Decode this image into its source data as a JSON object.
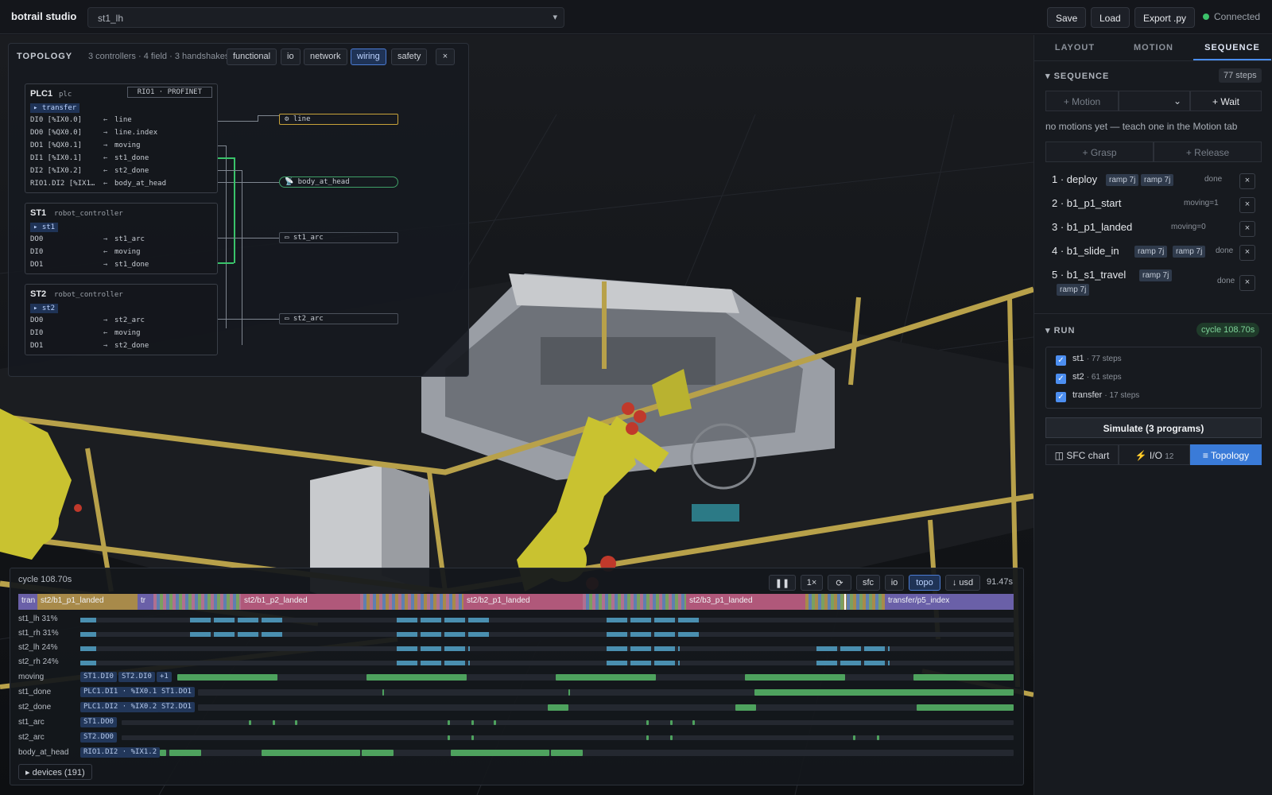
{
  "app": {
    "brand": "botrail studio",
    "project": "st1_lh",
    "save": "Save",
    "load": "Load",
    "export": "Export .py",
    "status": "Connected"
  },
  "topology": {
    "title": "TOPOLOGY",
    "summary": "3 controllers · 4 field · 3 handshakes",
    "chips": [
      "functional",
      "io",
      "network",
      "wiring",
      "safety"
    ],
    "close": "×",
    "plc1": {
      "name": "PLC1",
      "type": "plc",
      "rio": "RIO1 · PROFINET",
      "prog": "▸ transfer",
      "sigs": [
        [
          "DI0 [%IX0.0]",
          "←",
          "line"
        ],
        [
          "DO0 [%QX0.0]",
          "→",
          "line.index"
        ],
        [
          "DO1 [%QX0.1]",
          "→",
          "moving"
        ],
        [
          "DI1 [%IX0.1]",
          "←",
          "st1_done"
        ],
        [
          "DI2 [%IX0.2]",
          "←",
          "st2_done"
        ],
        [
          "RIO1.DI2 [%IX1…",
          "←",
          "body_at_head"
        ]
      ]
    },
    "st1": {
      "name": "ST1",
      "type": "robot_controller",
      "prog": "▸ st1",
      "sigs": [
        [
          "DO0",
          "→",
          "st1_arc"
        ],
        [
          "DI0",
          "←",
          "moving"
        ],
        [
          "DO1",
          "→",
          "st1_done"
        ]
      ]
    },
    "st2": {
      "name": "ST2",
      "type": "robot_controller",
      "prog": "▸ st2",
      "sigs": [
        [
          "DO0",
          "→",
          "st2_arc"
        ],
        [
          "DI0",
          "←",
          "moving"
        ],
        [
          "DO1",
          "→",
          "st2_done"
        ]
      ]
    },
    "devices": [
      "⚙ line",
      "📡 body_at_head",
      "▭ st1_arc",
      "▭ st2_arc"
    ]
  },
  "side": {
    "tabs": [
      "LAYOUT",
      "MOTION",
      "SEQUENCE"
    ],
    "sequence": {
      "title": "SEQUENCE",
      "count": "77 steps",
      "add_motion": "+ Motion",
      "add_wait": "+ Wait",
      "hint": "no motions yet — teach one in the Motion tab",
      "grasp": "+ Grasp",
      "release": "+ Release",
      "steps": [
        {
          "label": "1 · deploy",
          "tags": [
            "ramp 7j",
            "ramp 7j"
          ],
          "state": "done"
        },
        {
          "label": "2 · b1_p1_start",
          "tags": [],
          "state": "moving=1"
        },
        {
          "label": "3 · b1_p1_landed",
          "tags": [],
          "state": "moving=0"
        },
        {
          "label": "4 · b1_slide_in",
          "tags": [
            "ramp 7j",
            "ramp 7j"
          ],
          "state": "done"
        },
        {
          "label": "5 · b1_s1_travel",
          "tags": [
            "ramp 7j",
            "ramp 7j"
          ],
          "state": "done"
        }
      ]
    },
    "run": {
      "title": "RUN",
      "cycle": "cycle 108.70s",
      "programs": [
        {
          "name": "st1",
          "count": "· 77 steps"
        },
        {
          "name": "st2",
          "count": "· 61 steps"
        },
        {
          "name": "transfer",
          "count": "· 17 steps"
        }
      ],
      "simulate": "Simulate (3 programs)",
      "sfc": "◫ SFC chart",
      "io": "⚡ I/O",
      "io_count": "12",
      "topology": "≡ Topology"
    }
  },
  "timeline": {
    "cycle": "cycle 108.70s",
    "controls": [
      "❚❚",
      "1×",
      "⟳",
      "sfc",
      "io",
      "topo",
      "↓ usd"
    ],
    "time": "91.47s",
    "segments": [
      "tran",
      "st2/b1_p1_landed",
      "tr",
      "st2/b1_p2_landed",
      "st2/b2_p1_landed",
      "st2/b3_p1_landed",
      "transfer/p5_index"
    ],
    "rows": [
      {
        "label": "st1_lh 31%"
      },
      {
        "label": "st1_rh 31%"
      },
      {
        "label": "st2_lh 24%"
      },
      {
        "label": "st2_rh 24%"
      },
      {
        "label": "moving",
        "tags": [
          "ST1.DI0",
          "ST2.DI0",
          "+1"
        ]
      },
      {
        "label": "st1_done",
        "tags": [
          "PLC1.DI1 · %IX0.1",
          "ST1.DO1"
        ]
      },
      {
        "label": "st2_done",
        "tags": [
          "PLC1.DI2 · %IX0.2",
          "ST2.DO1"
        ]
      },
      {
        "label": "st1_arc",
        "tags": [
          "ST1.DO0"
        ]
      },
      {
        "label": "st2_arc",
        "tags": [
          "ST2.DO0"
        ]
      },
      {
        "label": "body_at_head",
        "tags": [
          "RIO1.DI2 · %IX1.2"
        ]
      }
    ],
    "devices": "▸ devices (191)"
  },
  "colors": {
    "accent": "#4a8ef0",
    "ok": "#3cc16a",
    "signal": "#4ea25e",
    "robot": "#c9c230"
  }
}
